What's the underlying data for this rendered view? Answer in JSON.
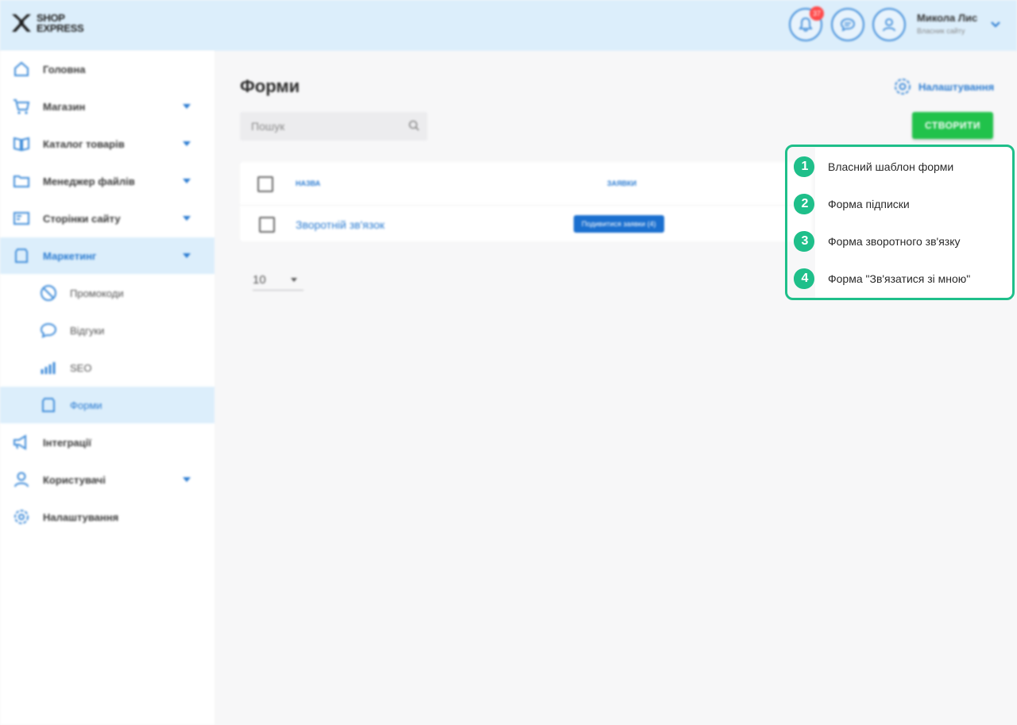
{
  "header": {
    "logo_line1": "SHOP",
    "logo_line2": "EXPRESS",
    "notifications_count": "37",
    "user_name": "Микола Лис",
    "user_subtitle": "Власник сайту"
  },
  "sidebar": {
    "items": [
      {
        "label": "Головна"
      },
      {
        "label": "Магазин"
      },
      {
        "label": "Каталог товарів"
      },
      {
        "label": "Менеджер файлів"
      },
      {
        "label": "Сторінки сайту"
      },
      {
        "label": "Маркетинг"
      },
      {
        "label": "Промокоди"
      },
      {
        "label": "Відгуки"
      },
      {
        "label": "SEO"
      },
      {
        "label": "Форми"
      },
      {
        "label": "Інтеграції"
      },
      {
        "label": "Користувачі"
      },
      {
        "label": "Налаштування"
      }
    ]
  },
  "main": {
    "title": "Форми",
    "settings_label": "Налаштування",
    "search_placeholder": "Пошук",
    "create_label": "СТВОРИТИ",
    "table": {
      "col_name": "НАЗВА",
      "col_requests": "ЗАЯВКИ",
      "rows": [
        {
          "name": "Зворотній зв'язок",
          "action": "Подивитися заявки (4)"
        }
      ]
    },
    "per_page": "10"
  },
  "dropdown": {
    "items": [
      {
        "num": "1",
        "label": "Власний шаблон форми"
      },
      {
        "num": "2",
        "label": "Форма підписки"
      },
      {
        "num": "3",
        "label": "Форма зворотного зв'язку"
      },
      {
        "num": "4",
        "label": "Форма \"Зв'язатися зі мною\""
      }
    ]
  },
  "colors": {
    "accent": "#2a7bd1",
    "create": "#21c24b",
    "callout": "#1fbf8a",
    "header_bg": "#dceefb"
  }
}
